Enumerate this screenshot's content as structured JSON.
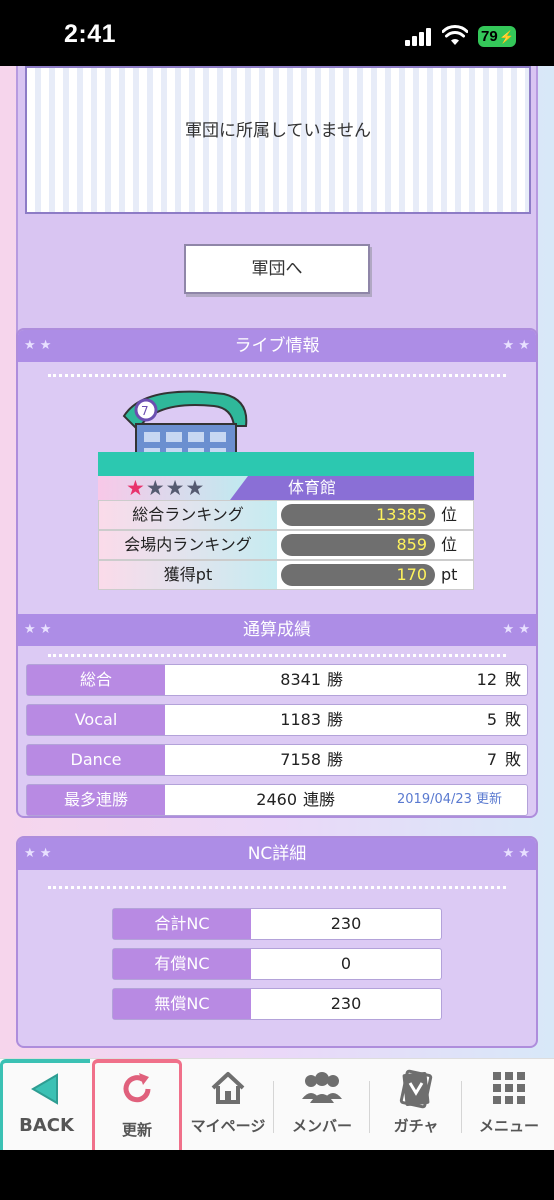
{
  "status_bar": {
    "time": "2:41",
    "battery": "79"
  },
  "guild": {
    "message": "軍団に所属していません",
    "button": "軍団へ"
  },
  "live": {
    "title": "ライブ情報",
    "venue_name": "体育館",
    "rankings": [
      {
        "label": "総合ランキング",
        "value": "13385",
        "unit": "位"
      },
      {
        "label": "会場内ランキング",
        "value": "859",
        "unit": "位"
      },
      {
        "label": "獲得pt",
        "value": "170",
        "unit": "pt"
      }
    ]
  },
  "record": {
    "title": "通算成績",
    "rows": [
      {
        "label": "総合",
        "wins": "8341",
        "wins_unit": "勝",
        "losses": "12",
        "losses_unit": "敗"
      },
      {
        "label": "Vocal",
        "wins": "1183",
        "wins_unit": "勝",
        "losses": "5",
        "losses_unit": "敗"
      },
      {
        "label": "Dance",
        "wins": "7158",
        "wins_unit": "勝",
        "losses": "7",
        "losses_unit": "敗"
      }
    ],
    "streak": {
      "label": "最多連勝",
      "value": "2460",
      "unit": "連勝",
      "date": "2019/04/23 更新"
    }
  },
  "nc": {
    "title": "NC詳細",
    "rows": [
      {
        "label": "合計NC",
        "value": "230"
      },
      {
        "label": "有償NC",
        "value": "0"
      },
      {
        "label": "無償NC",
        "value": "230"
      }
    ]
  },
  "nav": {
    "back": "BACK",
    "refresh": "更新",
    "mypage": "マイページ",
    "members": "メンバー",
    "gacha": "ガチャ",
    "menu": "メニュー"
  }
}
